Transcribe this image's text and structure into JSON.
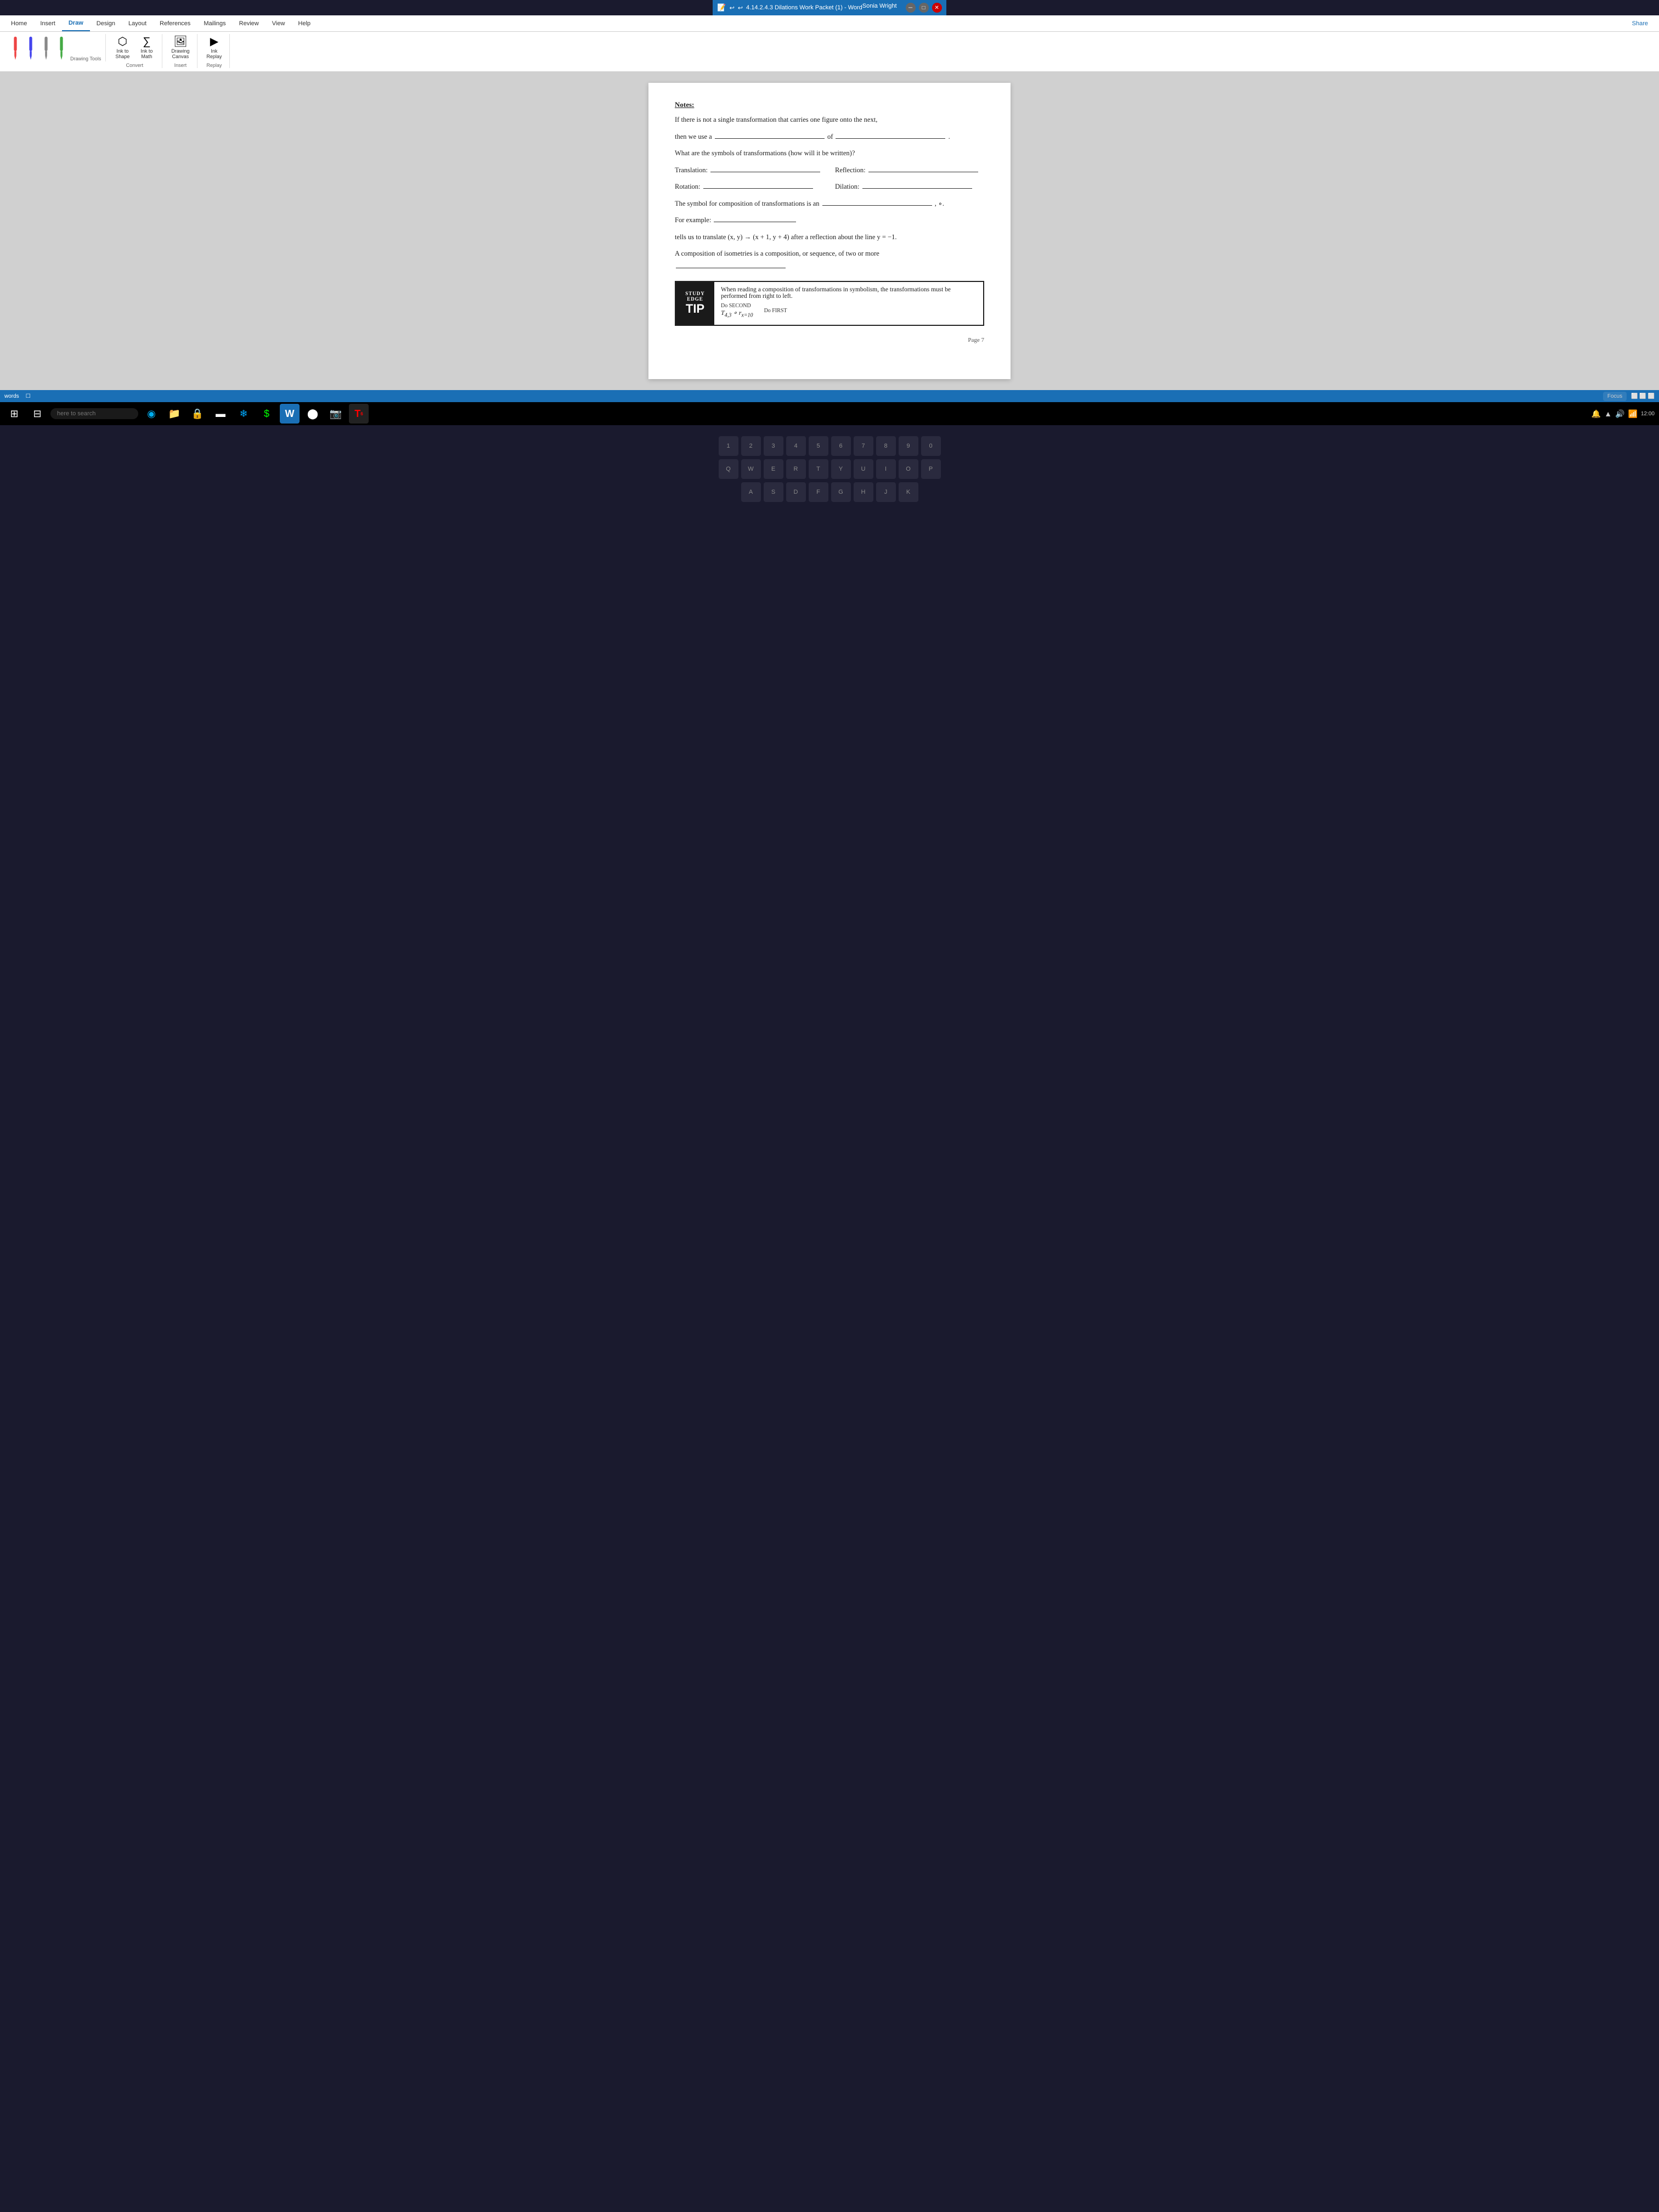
{
  "titlebar": {
    "title": "4.14.2.4.3 Dilations Work Packet (1) - Word",
    "user": "Sonia Wright",
    "share_label": "Share"
  },
  "ribbon": {
    "tabs": [
      {
        "label": "Home",
        "active": false
      },
      {
        "label": "Insert",
        "active": false
      },
      {
        "label": "Draw",
        "active": true
      },
      {
        "label": "Design",
        "active": false
      },
      {
        "label": "Layout",
        "active": false
      },
      {
        "label": "References",
        "active": false
      },
      {
        "label": "Mailings",
        "active": false
      },
      {
        "label": "Review",
        "active": false
      },
      {
        "label": "View",
        "active": false
      },
      {
        "label": "Help",
        "active": false
      }
    ],
    "groups": {
      "drawing_tools_label": "Drawing Tools",
      "convert_label": "Convert",
      "insert_label": "Insert",
      "replay_label": "Replay",
      "ink_to_shape": "Ink to\nShape",
      "ink_to_math": "Ink to\nMath",
      "drawing_canvas": "Drawing\nCanvas",
      "ink_replay": "Ink\nReplay"
    }
  },
  "document": {
    "notes_label": "Notes:",
    "line1": "If there is not a single transformation that carries one figure onto the next,",
    "line2_prefix": "then we use a",
    "line2_of": "of",
    "line3": "What are the symbols of transformations (how will it be written)?",
    "translation_label": "Translation:",
    "reflection_label": "Reflection:",
    "rotation_label": "Rotation:",
    "dilation_label": "Dilation:",
    "composition_line": "The symbol for composition of transformations is an",
    "for_example_label": "For example:",
    "tells_us_line": "tells us to translate (x, y) → (x + 1, y + 4) after a reflection about the line y = −1.",
    "isometries_line": "A composition of isometries is a composition, or sequence, of two or more",
    "study_tip": {
      "study_edge": "STUDY\nEDGE",
      "tip_label": "TIP",
      "content": "When reading a composition of transformations in symbolism, the transformations must be performed from right to left.",
      "math_notation": "T₄,₃ ∘ rₓ₌₁₀",
      "do_second": "Do SECOND",
      "do_first": "Do FIRST"
    },
    "page_number": "Page 7"
  },
  "statusbar": {
    "words_label": "words",
    "focus_label": "Focus"
  },
  "taskbar": {
    "search_placeholder": "here to search",
    "buttons": [
      "⊞",
      "⊟",
      "●",
      "📁",
      "🔒",
      "▬",
      "❄",
      "$",
      "W",
      "⬤",
      "📷",
      "T"
    ]
  }
}
